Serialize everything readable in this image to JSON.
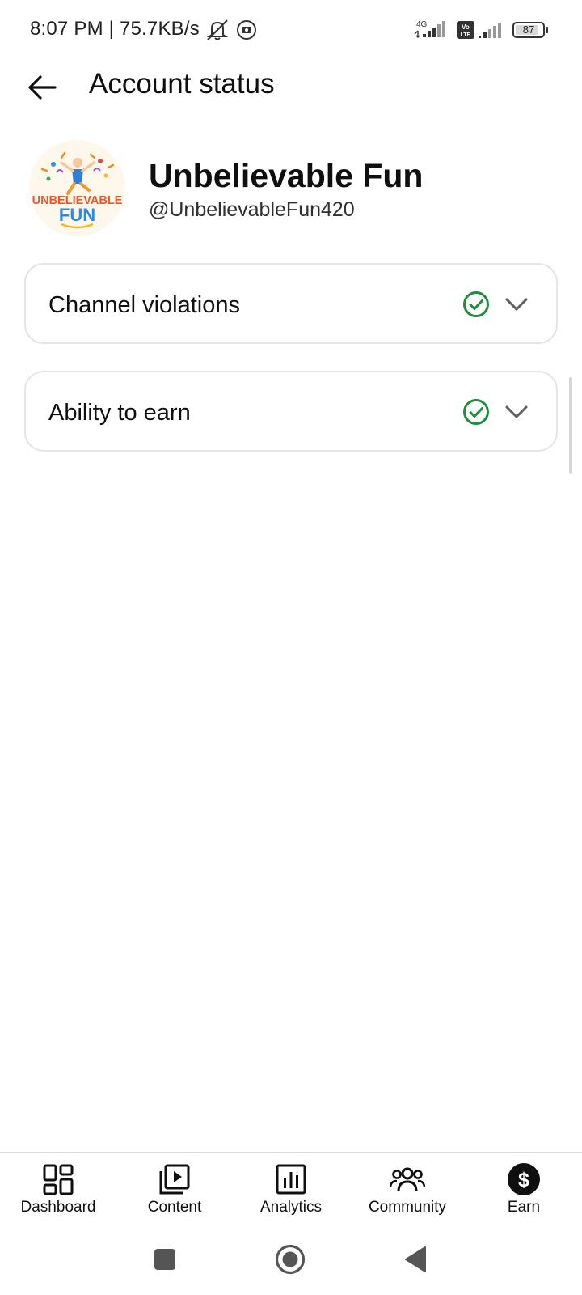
{
  "status_bar": {
    "time_speed": "8:07 PM | 75.7KB/s",
    "network_label": "4G",
    "volte_label": "Vo LTE",
    "battery_level": "87"
  },
  "app_bar": {
    "title": "Account status"
  },
  "channel": {
    "name": "Unbelievable Fun",
    "handle": "@UnbelievableFun420",
    "avatar_text_top": "UNBELIEVABLE",
    "avatar_text_bottom": "FUN"
  },
  "cards": [
    {
      "label": "Channel violations",
      "status": "ok"
    },
    {
      "label": "Ability to earn",
      "status": "ok"
    }
  ],
  "colors": {
    "check_green": "#1e8e3e",
    "chevron_gray": "#606060",
    "text_primary": "#0f0f0f"
  },
  "bottom_nav": {
    "items": [
      {
        "label": "Dashboard",
        "icon": "dashboard-icon",
        "active": false
      },
      {
        "label": "Content",
        "icon": "content-icon",
        "active": false
      },
      {
        "label": "Analytics",
        "icon": "analytics-icon",
        "active": false
      },
      {
        "label": "Community",
        "icon": "community-icon",
        "active": false
      },
      {
        "label": "Earn",
        "icon": "earn-icon",
        "active": true
      }
    ]
  }
}
